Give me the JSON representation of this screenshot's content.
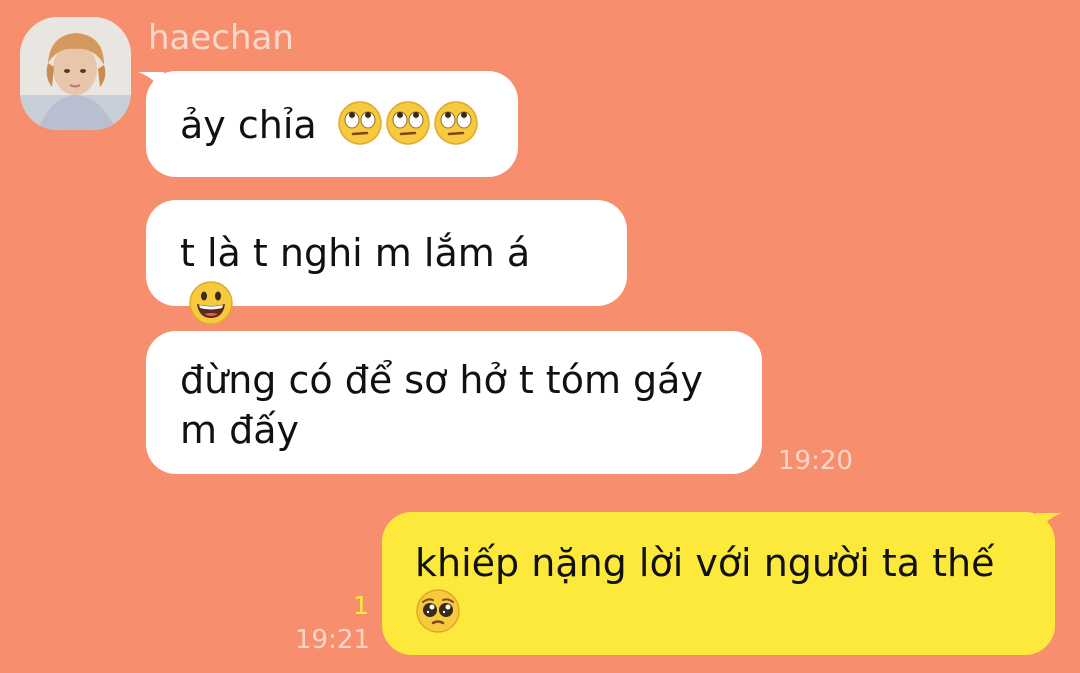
{
  "contact": {
    "name": "haechan",
    "avatar_icon": "profile-photo"
  },
  "messages": [
    {
      "direction": "incoming",
      "text": "ảy chỉa",
      "emoji": [
        "eye-roll-face-icon",
        "eye-roll-face-icon",
        "eye-roll-face-icon"
      ]
    },
    {
      "direction": "incoming",
      "text": "t là t nghi m lắm á",
      "emoji": [
        "grinning-face-icon"
      ]
    },
    {
      "direction": "incoming",
      "text_line1": "đừng có để sơ hở t tóm gáy",
      "text_line2": "m đấy",
      "time": "19:20"
    },
    {
      "direction": "outgoing",
      "text": "khiếp nặng lời với người ta thế",
      "emoji": [
        "pleading-face-icon"
      ],
      "time": "19:21",
      "unread_count": "1"
    }
  ],
  "colors": {
    "background": "#f78f6e",
    "incoming_bubble": "#ffffff",
    "outgoing_bubble": "#fde93b",
    "timestamp": "#fcd5c6"
  }
}
